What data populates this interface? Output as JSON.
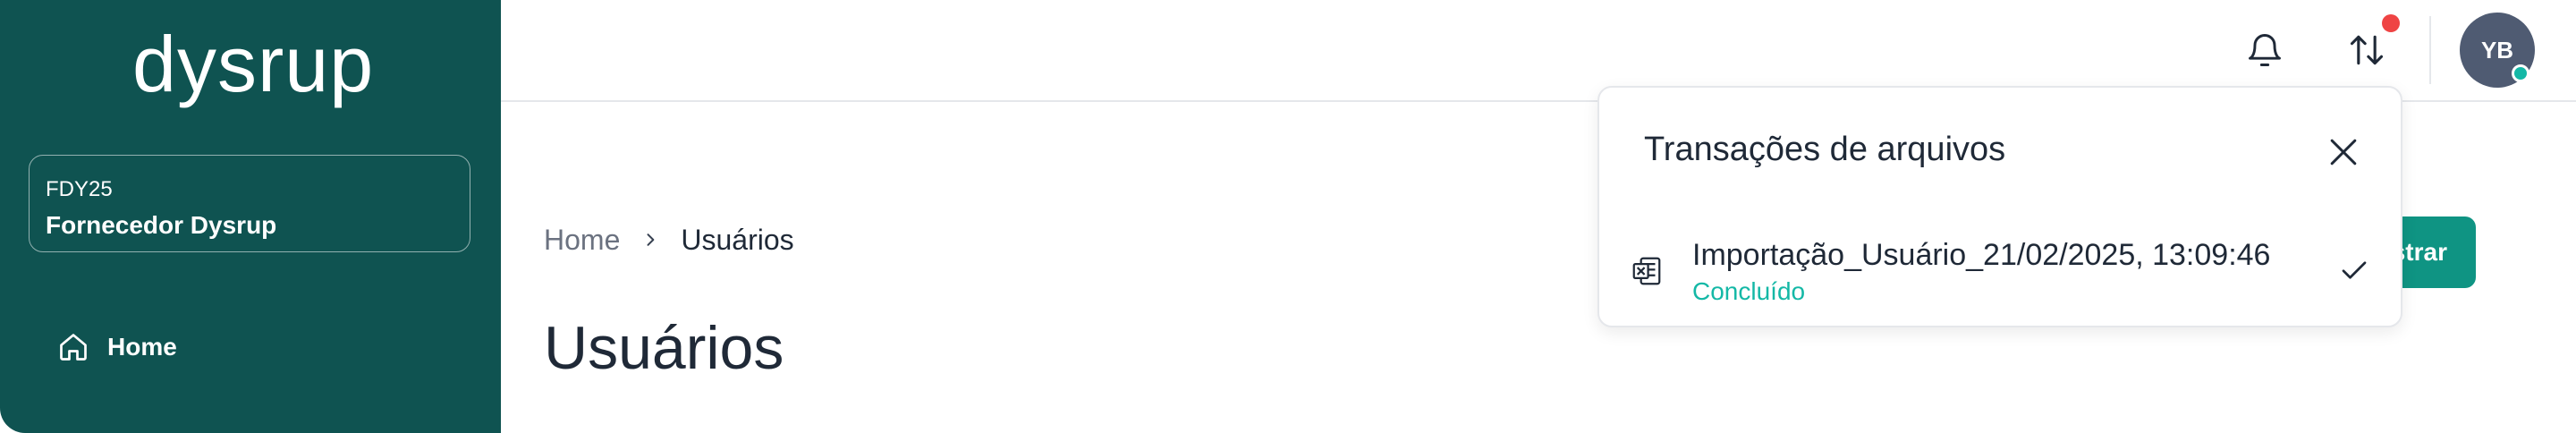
{
  "sidebar": {
    "logo": "dysrup",
    "organization": {
      "code": "FDY25",
      "name": "Fornecedor Dysrup"
    },
    "nav": [
      {
        "label": "Home",
        "icon": "home-icon"
      }
    ]
  },
  "header": {
    "icons": [
      "bell-icon",
      "transfer-icon"
    ],
    "avatar_initials": "YB",
    "notification_color": "#ef4444",
    "online_color": "#14b8a6"
  },
  "breadcrumb": {
    "home": "Home",
    "current": "Usuários"
  },
  "page": {
    "title": "Usuários"
  },
  "actions": {
    "register_partial": "strar"
  },
  "file_transactions": {
    "title": "Transações de arquivos",
    "items": [
      {
        "name": "Importação_Usuário_21/02/2025, 13:09:46",
        "status": "Concluído",
        "icon": "excel-file-icon"
      }
    ]
  },
  "colors": {
    "sidebar": "#0f5351",
    "accent": "#0f9483",
    "success_text": "#14b8a6"
  }
}
